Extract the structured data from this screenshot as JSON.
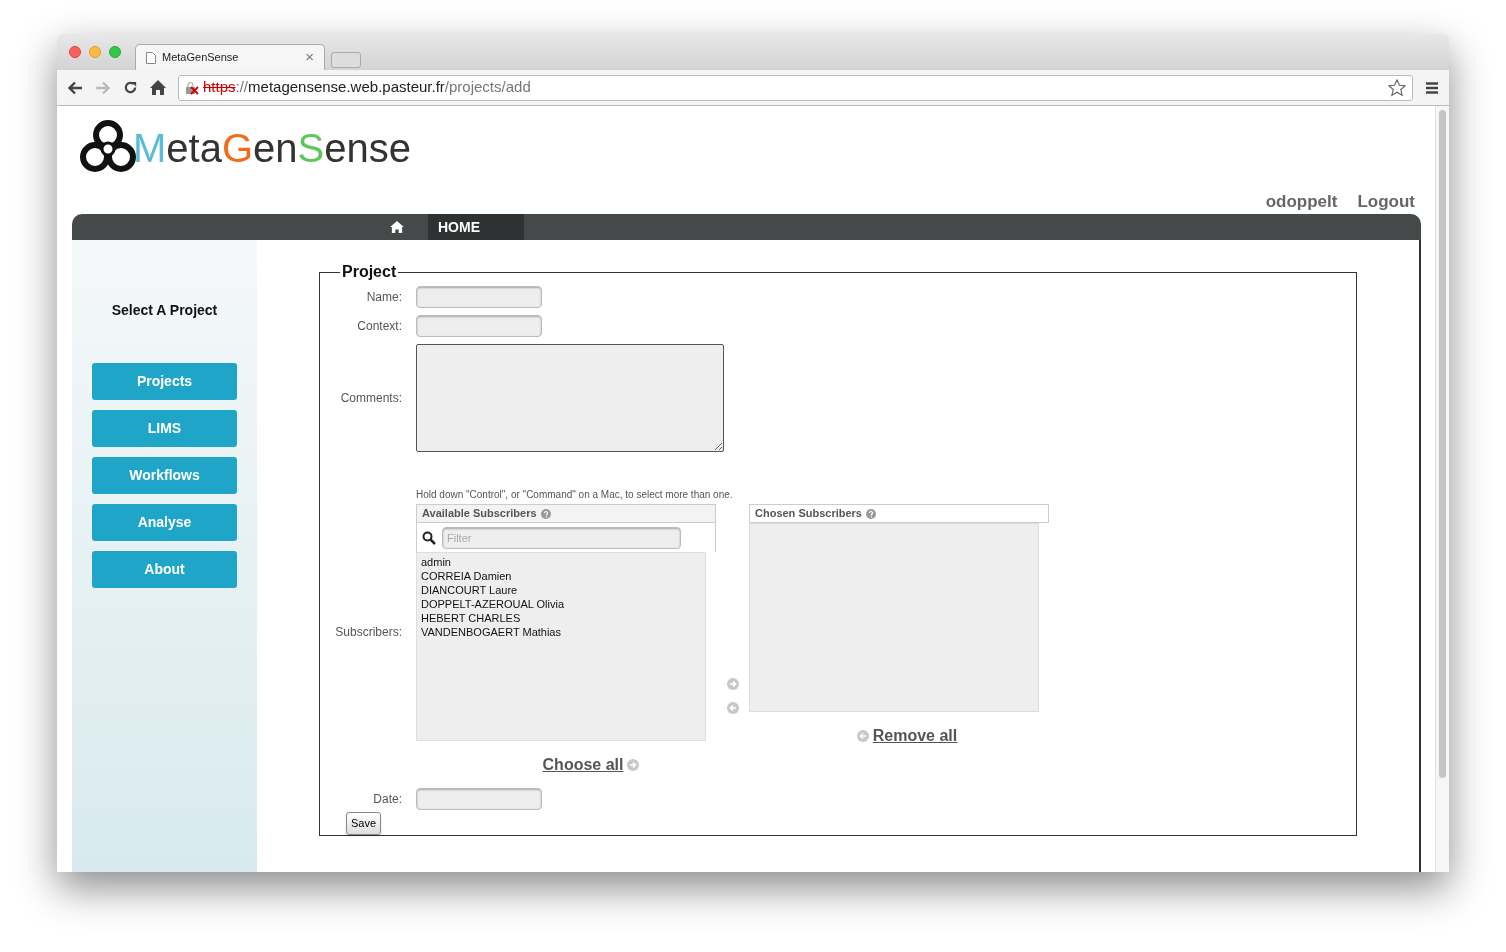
{
  "browser": {
    "tab_title": "MetaGenSense",
    "tab_close": "×",
    "url": [
      {
        "kind": "insecure",
        "text": "https"
      },
      {
        "kind": "path",
        "text": "://"
      },
      {
        "kind": "host",
        "text": "metagensense.web.pasteur.fr"
      },
      {
        "kind": "path",
        "text": "/projects/add"
      }
    ]
  },
  "logo": [
    {
      "text": "M",
      "color": "#5bbcd6"
    },
    {
      "text": "eta",
      "color": "#333333"
    },
    {
      "text": "G",
      "color": "#f26a1b"
    },
    {
      "text": "en",
      "color": "#333333"
    },
    {
      "text": "S",
      "color": "#5cc85a"
    },
    {
      "text": "ense",
      "color": "#333333"
    }
  ],
  "user_links": [
    "odoppelt",
    "Logout"
  ],
  "nav": {
    "items": [
      {
        "label": "HOME",
        "selected": true
      }
    ]
  },
  "sidebar": {
    "title": "Select A Project",
    "buttons": [
      "Projects",
      "LIMS",
      "Workflows",
      "Analyse",
      "About"
    ]
  },
  "form": {
    "legend": "Project",
    "name_label": "Name:",
    "context_label": "Context:",
    "comments_label": "Comments:",
    "subscribers_label": "Subscribers:",
    "date_label": "Date:",
    "help": "Hold down \"Control\", or \"Command\" on a Mac, to select more than one.",
    "available": {
      "title": "Available Subscribers",
      "filter_placeholder": "Filter",
      "options": [
        "admin",
        "CORREIA Damien",
        "DIANCOURT Laure",
        "DOPPELT-AZEROUAL Olivia",
        "HEBERT CHARLES",
        "VANDENBOGAERT Mathias"
      ]
    },
    "chosen": {
      "title": "Chosen Subscribers"
    },
    "choose_all": "Choose all",
    "remove_all": "Remove all",
    "save": "Save"
  }
}
